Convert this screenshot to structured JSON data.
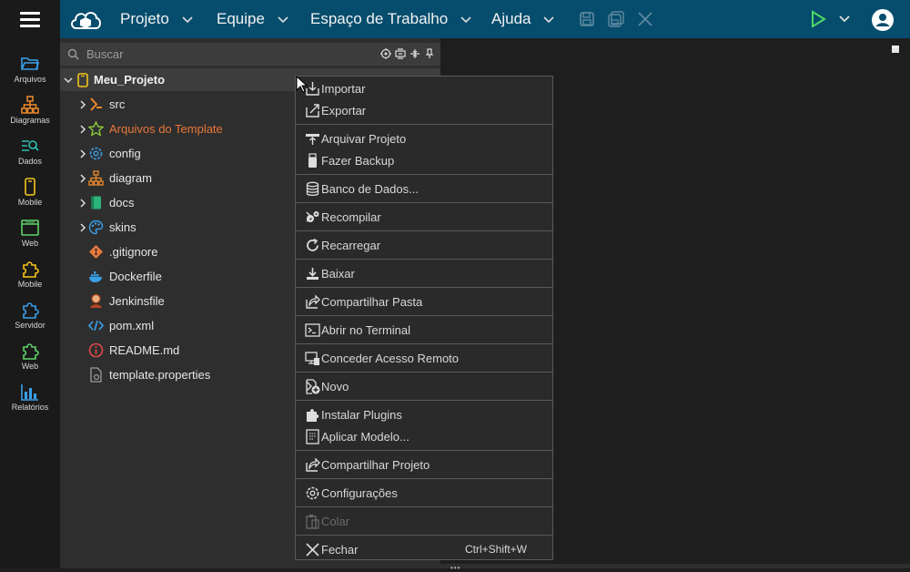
{
  "topbar": {
    "menus": [
      {
        "label": "Projeto"
      },
      {
        "label": "Equipe"
      },
      {
        "label": "Espaço de Trabalho"
      },
      {
        "label": "Ajuda"
      }
    ]
  },
  "sidebar": {
    "items": [
      {
        "label": "Arquivos",
        "icon": "folder-icon",
        "color": "#3aa0e8"
      },
      {
        "label": "Diagramas",
        "icon": "diagram-icon",
        "color": "#f08a2c"
      },
      {
        "label": "Dados",
        "icon": "data-search-icon",
        "color": "#2bc1b4"
      },
      {
        "label": "Mobile",
        "icon": "mobile-icon",
        "color": "#f5c518"
      },
      {
        "label": "Web",
        "icon": "browser-icon",
        "color": "#5fd36b"
      },
      {
        "label": "Mobile",
        "icon": "puzzle-icon",
        "color": "#f5c518"
      },
      {
        "label": "Servidor",
        "icon": "puzzle-icon",
        "color": "#3aa0e8"
      },
      {
        "label": "Web",
        "icon": "puzzle-icon",
        "color": "#5fd36b"
      },
      {
        "label": "Relatórios",
        "icon": "bar-chart-icon",
        "color": "#3aa0e8"
      }
    ]
  },
  "tree": {
    "search_placeholder": "Buscar",
    "root": "Meu_Projeto",
    "items": [
      {
        "label": "src",
        "icon": "source-icon",
        "folder": true
      },
      {
        "label": "Arquivos do Template",
        "icon": "star-icon",
        "folder": true,
        "highlight": "#e8773a"
      },
      {
        "label": "config",
        "icon": "gear-icon",
        "folder": true
      },
      {
        "label": "diagram",
        "icon": "diagram-icon",
        "folder": true
      },
      {
        "label": "docs",
        "icon": "book-icon",
        "folder": true
      },
      {
        "label": "skins",
        "icon": "palette-icon",
        "folder": true
      },
      {
        "label": ".gitignore",
        "icon": "git-icon",
        "folder": false
      },
      {
        "label": "Dockerfile",
        "icon": "docker-icon",
        "folder": false
      },
      {
        "label": "Jenkinsfile",
        "icon": "jenkins-icon",
        "folder": false
      },
      {
        "label": "pom.xml",
        "icon": "code-icon",
        "folder": false
      },
      {
        "label": "README.md",
        "icon": "info-icon",
        "folder": false
      },
      {
        "label": "template.properties",
        "icon": "file-gear-icon",
        "folder": false
      }
    ]
  },
  "context_menu": {
    "items": [
      {
        "label": "Importar"
      },
      {
        "label": "Exportar"
      },
      {
        "label": "Arquivar Projeto"
      },
      {
        "label": "Fazer Backup"
      },
      {
        "label": "Banco de Dados..."
      },
      {
        "label": "Recompilar"
      },
      {
        "label": "Recarregar"
      },
      {
        "label": "Baixar"
      },
      {
        "label": "Compartilhar Pasta"
      },
      {
        "label": "Abrir no Terminal"
      },
      {
        "label": "Conceder Acesso Remoto"
      },
      {
        "label": "Novo"
      },
      {
        "label": "Instalar Plugins"
      },
      {
        "label": "Aplicar Modelo..."
      },
      {
        "label": "Compartilhar Projeto"
      },
      {
        "label": "Configurações"
      },
      {
        "label": "Colar"
      },
      {
        "label": "Fechar",
        "shortcut": "Ctrl+Shift+W"
      }
    ]
  }
}
